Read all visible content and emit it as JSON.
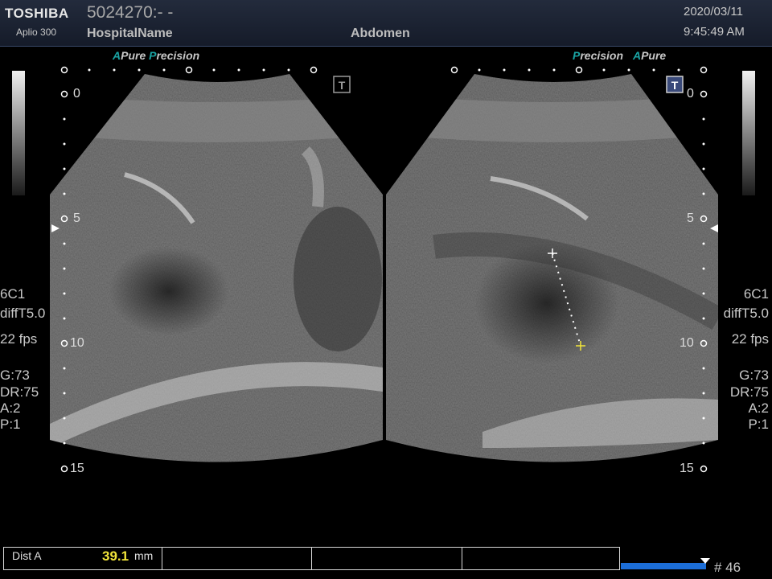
{
  "header": {
    "brand": "TOSHIBA",
    "model": "Aplio 300",
    "patient_id": "5024270:- -",
    "hospital": "HospitalName",
    "exam": "Abdomen",
    "date": "2020/03/11",
    "time": "9:45:49 AM"
  },
  "precision_labels": {
    "left": {
      "a1": "A",
      "w1": "Pure",
      "a2": "P",
      "w2": "recision"
    },
    "right": {
      "a1": "P",
      "w1": "recision",
      "a2": "A",
      "w2": "Pure"
    }
  },
  "left_params": {
    "probe": "6C1",
    "mode": "diffT5.0",
    "fps": "22 fps",
    "gain": "G:73",
    "dr": "DR:75",
    "a": "A:2",
    "p": "P:1"
  },
  "right_params": {
    "probe": "6C1",
    "mode": "diffT5.0",
    "fps": "22 fps",
    "gain": "G:73",
    "dr": "DR:75",
    "a": "A:2",
    "p": "P:1"
  },
  "depth_marks": [
    "0",
    "5",
    "10",
    "15"
  ],
  "measurement": {
    "label": "Dist A",
    "value": "39.1",
    "unit": "mm"
  },
  "frame_counter": "# 46",
  "colors": {
    "header_bg": "#1b2232",
    "accent_teal": "#1aa3a3",
    "measure_value": "#f2e53a",
    "cine_bar": "#1c6ed8"
  }
}
